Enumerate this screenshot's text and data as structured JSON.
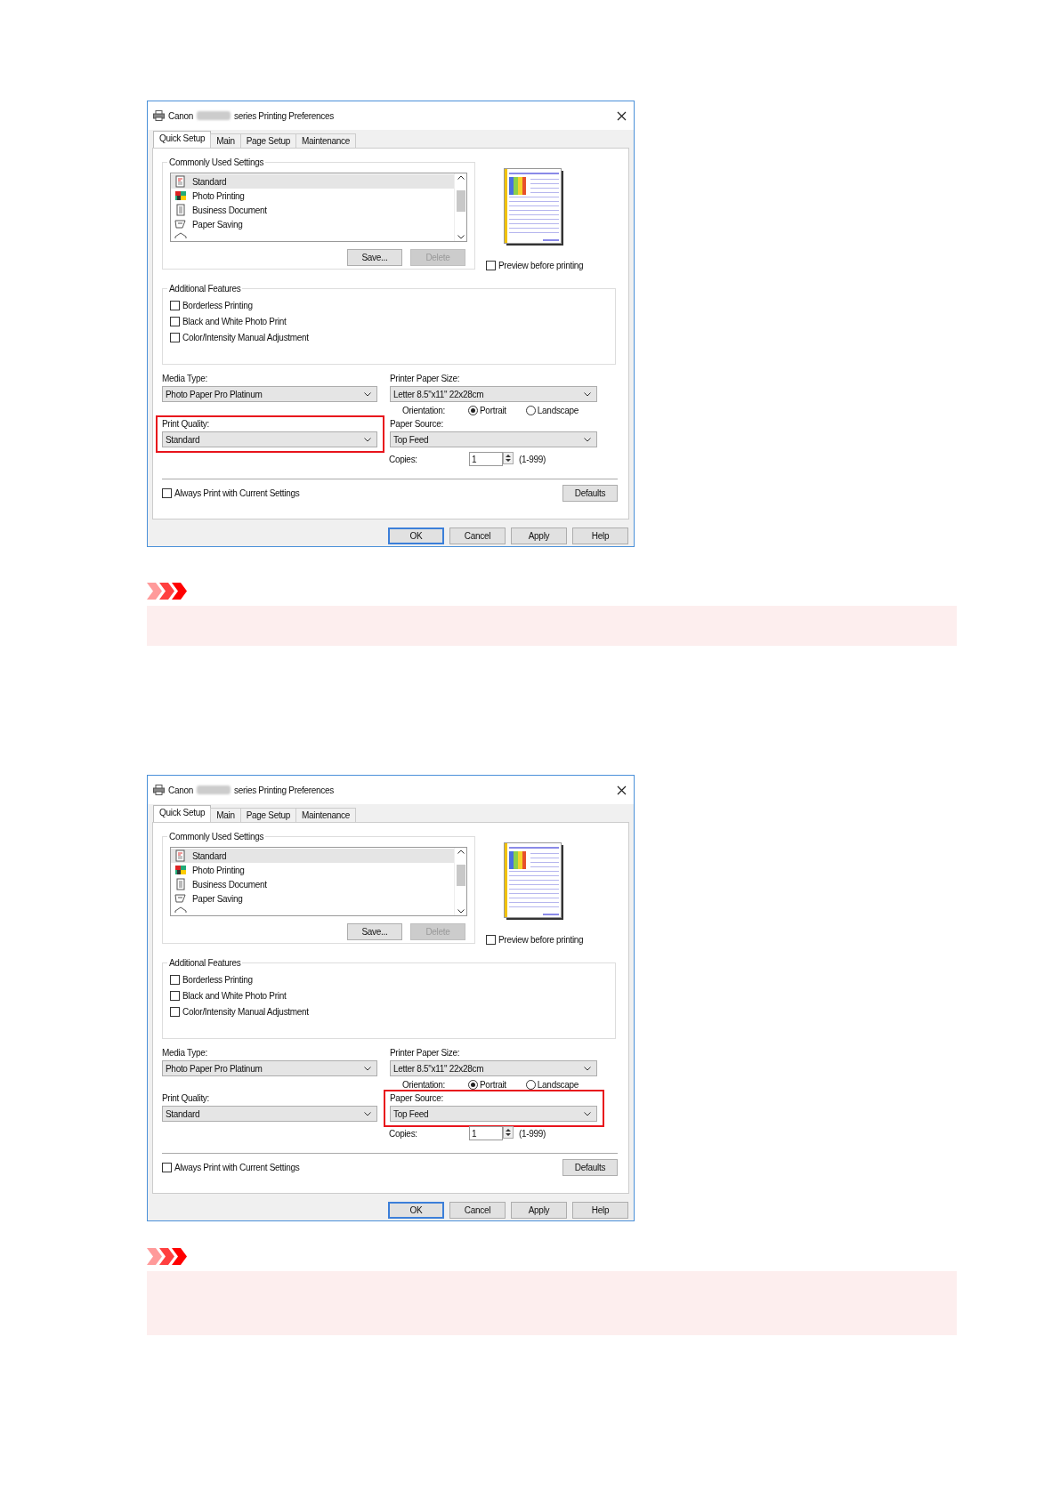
{
  "dialogs": [
    {
      "title": {
        "brand": "Canon",
        "rest": "series Printing Preferences"
      },
      "tabs": [
        {
          "label": "Quick Setup",
          "selected": true
        },
        {
          "label": "Main",
          "selected": false
        },
        {
          "label": "Page Setup",
          "selected": false
        },
        {
          "label": "Maintenance",
          "selected": false
        }
      ],
      "commonly_used": {
        "label": "Commonly Used Settings",
        "items": [
          {
            "label": "Standard",
            "selected": true
          },
          {
            "label": "Photo Printing",
            "selected": false
          },
          {
            "label": "Business Document",
            "selected": false
          },
          {
            "label": "Paper Saving",
            "selected": false
          }
        ],
        "buttons": [
          {
            "label": "Save...",
            "disabled": false
          },
          {
            "label": "Delete",
            "disabled": true
          }
        ]
      },
      "preview_before_printing": {
        "label": "Preview before printing",
        "checked": false
      },
      "additional_features": {
        "label": "Additional Features",
        "options": [
          {
            "label": "Borderless Printing",
            "checked": false
          },
          {
            "label": "Black and White Photo Print",
            "checked": false
          },
          {
            "label": "Color/Intensity Manual Adjustment",
            "checked": false
          }
        ]
      },
      "media_type": {
        "label": "Media Type:",
        "value": "Photo Paper Pro Platinum",
        "highlighted": false
      },
      "printer_paper_size": {
        "label": "Printer Paper Size:",
        "value": "Letter 8.5\"x11\" 22x28cm",
        "highlighted": false
      },
      "orientation": {
        "label": "Orientation:",
        "options": [
          {
            "label": "Portrait",
            "selected": true
          },
          {
            "label": "Landscape",
            "selected": false
          }
        ]
      },
      "print_quality": {
        "label": "Print Quality:",
        "value": "Standard",
        "highlighted": true
      },
      "paper_source": {
        "label": "Paper Source:",
        "value": "Top Feed",
        "highlighted": false
      },
      "copies": {
        "label": "Copies:",
        "value": "1",
        "range": "(1-999)"
      },
      "always_print": {
        "label": "Always Print with Current Settings",
        "checked": false
      },
      "defaults_button": "Defaults",
      "buttons": [
        {
          "label": "OK",
          "default": true
        },
        {
          "label": "Cancel",
          "default": false
        },
        {
          "label": "Apply",
          "default": false
        },
        {
          "label": "Help",
          "default": false
        }
      ]
    },
    {
      "title": {
        "brand": "Canon",
        "rest": "series Printing Preferences"
      },
      "tabs": [
        {
          "label": "Quick Setup",
          "selected": true
        },
        {
          "label": "Main",
          "selected": false
        },
        {
          "label": "Page Setup",
          "selected": false
        },
        {
          "label": "Maintenance",
          "selected": false
        }
      ],
      "commonly_used": {
        "label": "Commonly Used Settings",
        "items": [
          {
            "label": "Standard",
            "selected": true
          },
          {
            "label": "Photo Printing",
            "selected": false
          },
          {
            "label": "Business Document",
            "selected": false
          },
          {
            "label": "Paper Saving",
            "selected": false
          }
        ],
        "buttons": [
          {
            "label": "Save...",
            "disabled": false
          },
          {
            "label": "Delete",
            "disabled": true
          }
        ]
      },
      "preview_before_printing": {
        "label": "Preview before printing",
        "checked": false
      },
      "additional_features": {
        "label": "Additional Features",
        "options": [
          {
            "label": "Borderless Printing",
            "checked": false
          },
          {
            "label": "Black and White Photo Print",
            "checked": false
          },
          {
            "label": "Color/Intensity Manual Adjustment",
            "checked": false
          }
        ]
      },
      "media_type": {
        "label": "Media Type:",
        "value": "Photo Paper Pro Platinum",
        "highlighted": false
      },
      "printer_paper_size": {
        "label": "Printer Paper Size:",
        "value": "Letter 8.5\"x11\" 22x28cm",
        "highlighted": false
      },
      "orientation": {
        "label": "Orientation:",
        "options": [
          {
            "label": "Portrait",
            "selected": true
          },
          {
            "label": "Landscape",
            "selected": false
          }
        ]
      },
      "print_quality": {
        "label": "Print Quality:",
        "value": "Standard",
        "highlighted": false
      },
      "paper_source": {
        "label": "Paper Source:",
        "value": "Top Feed",
        "highlighted": true
      },
      "copies": {
        "label": "Copies:",
        "value": "1",
        "range": "(1-999)"
      },
      "always_print": {
        "label": "Always Print with Current Settings",
        "checked": false
      },
      "defaults_button": "Defaults",
      "buttons": [
        {
          "label": "OK",
          "default": true
        },
        {
          "label": "Cancel",
          "default": false
        },
        {
          "label": "Apply",
          "default": false
        },
        {
          "label": "Help",
          "default": false
        }
      ]
    }
  ]
}
